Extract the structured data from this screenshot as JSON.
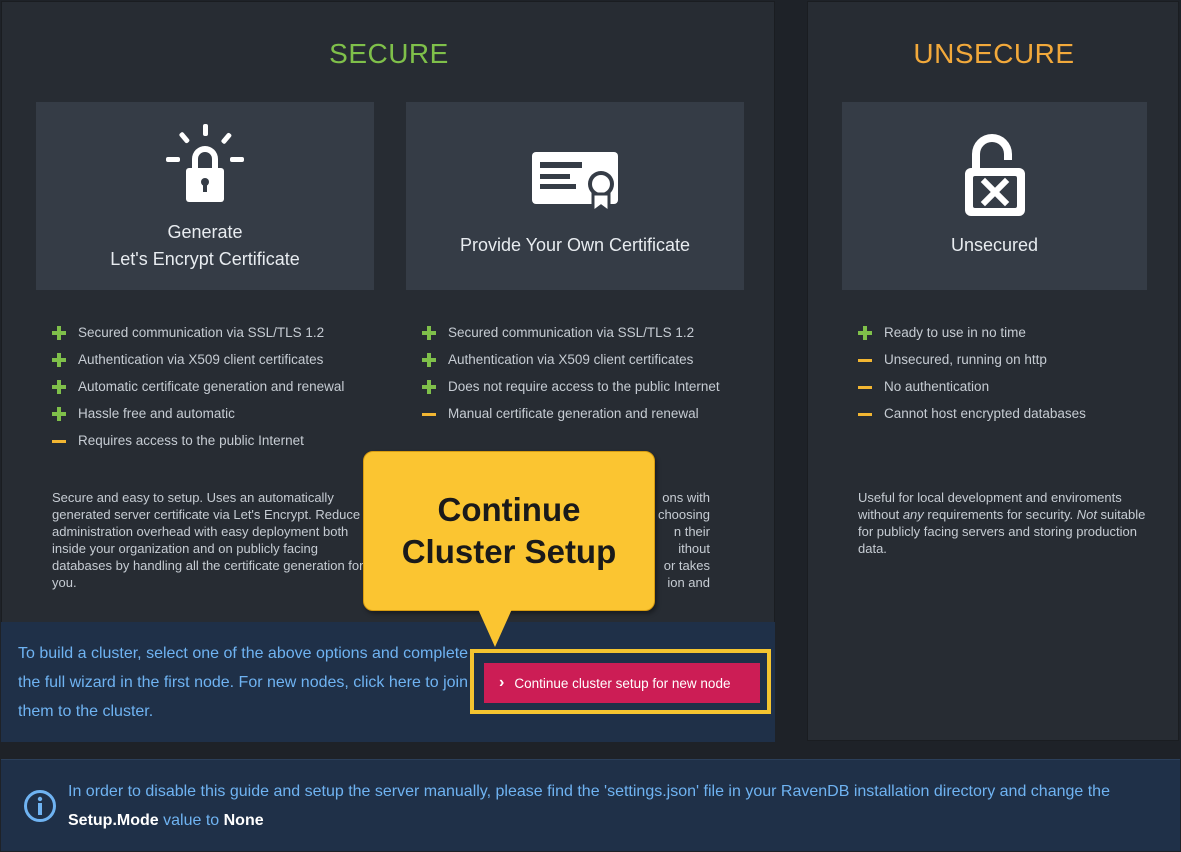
{
  "secure": {
    "title": "SECURE",
    "cards": [
      {
        "icon": "lock-sparkle-icon",
        "label_line1": "Generate",
        "label_line2": "Let's Encrypt Certificate",
        "features": [
          {
            "type": "plus",
            "text": "Secured communication via SSL/TLS 1.2"
          },
          {
            "type": "plus",
            "text": "Authentication via X509 client certificates"
          },
          {
            "type": "plus",
            "text": "Automatic certificate generation and renewal"
          },
          {
            "type": "plus",
            "text": "Hassle free and automatic"
          },
          {
            "type": "minus",
            "text": "Requires access to the public Internet"
          }
        ],
        "description": "Secure and easy to setup. Uses an automatically generated server certificate via Let's Encrypt. Reduce administration overhead with easy deployment both inside your organization and on publicly facing databases by handling all the certificate generation for you."
      },
      {
        "icon": "certificate-icon",
        "label": "Provide Your Own Certificate",
        "features": [
          {
            "type": "plus",
            "text": "Secured communication via SSL/TLS 1.2"
          },
          {
            "type": "plus",
            "text": "Authentication via X509 client certificates"
          },
          {
            "type": "plus",
            "text": "Does not require access to the public Internet"
          },
          {
            "type": "minus",
            "text": "Manual certificate generation and renewal"
          }
        ],
        "description_fragments": [
          "ons with",
          "e choosing",
          "n their",
          "ithout",
          "or takes",
          "ion and"
        ]
      }
    ]
  },
  "unsecure": {
    "title": "UNSECURE",
    "card": {
      "icon": "unlocked-x-icon",
      "label": "Unsecured",
      "features": [
        {
          "type": "plus",
          "text": "Ready to use in no time"
        },
        {
          "type": "minus",
          "text": "Unsecured, running on http"
        },
        {
          "type": "minus",
          "text": "No authentication"
        },
        {
          "type": "minus",
          "text": "Cannot host encrypted databases"
        }
      ],
      "description_part1": "Useful for local development and enviroments without ",
      "description_em1": "any",
      "description_part2": " requirements for security. ",
      "description_em2": "Not",
      "description_part3": " suitable for publicly facing servers and storing production data."
    }
  },
  "cluster": {
    "text": "To build a cluster, select one of the above options and complete the full wizard in the first node. For new nodes, click here to join them to the cluster.",
    "button_label": "Continue cluster setup for new node",
    "button_icon": "chevron-right-icon"
  },
  "callout": {
    "line1": "Continue",
    "line2": "Cluster Setup"
  },
  "guide": {
    "icon": "info-icon",
    "text_part1": "In order to disable this guide and setup the server manually, please find the 'settings.json' file in your RavenDB installation directory and change the ",
    "setting_key": "Setup.Mode",
    "text_part2": " value to ",
    "setting_value": "None"
  }
}
